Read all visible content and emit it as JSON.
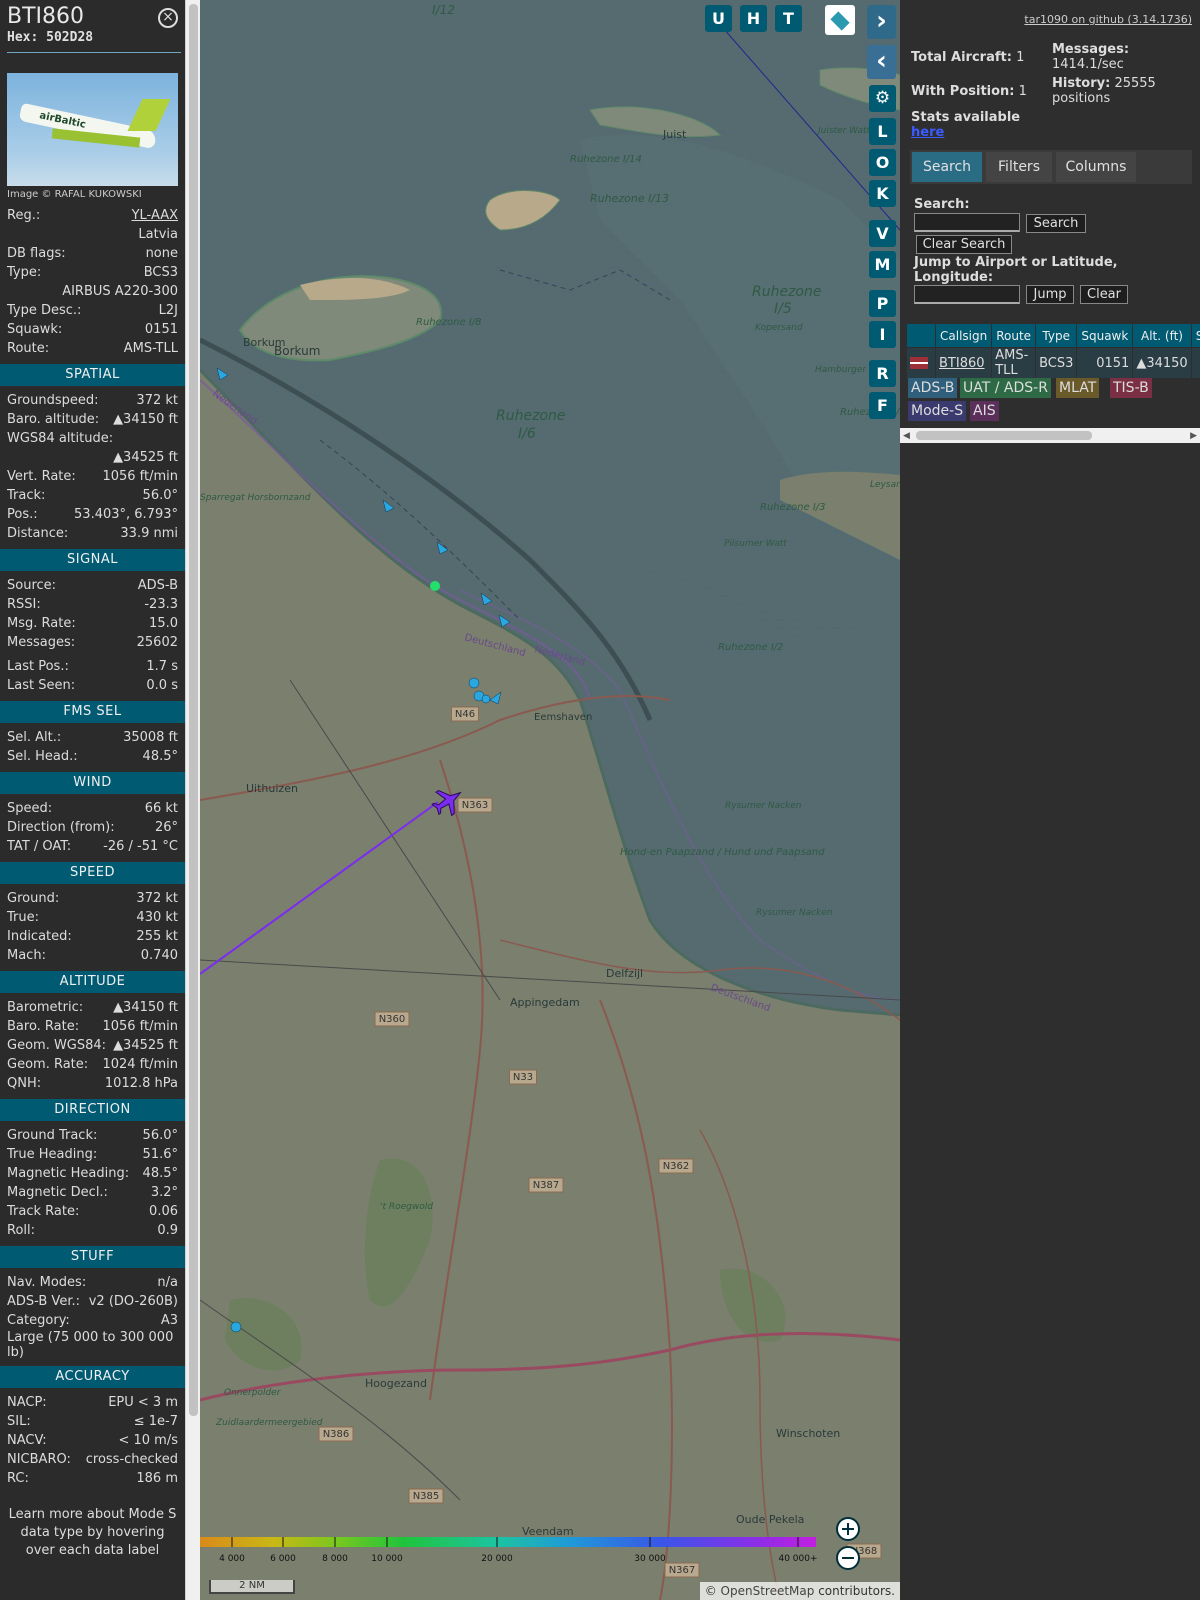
{
  "info": {
    "callsign": "BTI860",
    "hex_label": "Hex:",
    "hex": "502D28",
    "close_icon": "×",
    "photo_text": "airBaltic",
    "image_credit": "Image © RAFAL KUKOWSKI",
    "basic": [
      {
        "k": "Reg.:",
        "v": "YL-AAX"
      },
      {
        "k": "",
        "v": "Latvia"
      },
      {
        "k": "DB flags:",
        "v": "none"
      },
      {
        "k": "Type:",
        "v": "BCS3"
      },
      {
        "k": "",
        "v": "AIRBUS A220-300"
      },
      {
        "k": "Type Desc.:",
        "v": "L2J"
      },
      {
        "k": "Squawk:",
        "v": "0151"
      },
      {
        "k": "Route:",
        "v": "AMS-TLL"
      }
    ],
    "sections": {
      "spatial": "SPATIAL",
      "signal": "SIGNAL",
      "fms": "FMS SEL",
      "wind": "WIND",
      "speed": "SPEED",
      "altitude": "ALTITUDE",
      "direction": "DIRECTION",
      "stuff": "STUFF",
      "accuracy": "ACCURACY"
    },
    "spatial": [
      {
        "k": "Groundspeed:",
        "v": "372 kt"
      },
      {
        "k": "Baro. altitude:",
        "v": "▲34150 ft"
      },
      {
        "k": "WGS84 altitude:",
        "v": ""
      },
      {
        "k": "",
        "v": "▲34525 ft"
      },
      {
        "k": "Vert. Rate:",
        "v": "1056 ft/min"
      },
      {
        "k": "Track:",
        "v": "56.0°"
      },
      {
        "k": "Pos.:",
        "v": "53.403°, 6.793°"
      },
      {
        "k": "Distance:",
        "v": "33.9 nmi"
      }
    ],
    "signal": [
      {
        "k": "Source:",
        "v": "ADS-B"
      },
      {
        "k": "RSSI:",
        "v": "-23.3"
      },
      {
        "k": "Msg. Rate:",
        "v": "15.0"
      },
      {
        "k": "Messages:",
        "v": "25602"
      },
      {
        "k": "Last Pos.:",
        "v": "1.7 s"
      },
      {
        "k": "Last Seen:",
        "v": "0.0 s"
      }
    ],
    "fms": [
      {
        "k": "Sel. Alt.:",
        "v": "35008 ft"
      },
      {
        "k": "Sel. Head.:",
        "v": "48.5°"
      }
    ],
    "wind": [
      {
        "k": "Speed:",
        "v": "66 kt"
      },
      {
        "k": "Direction (from):",
        "v": "26°"
      },
      {
        "k": "TAT / OAT:",
        "v": "-26 / -51 °C"
      }
    ],
    "speed": [
      {
        "k": "Ground:",
        "v": "372 kt"
      },
      {
        "k": "True:",
        "v": "430 kt"
      },
      {
        "k": "Indicated:",
        "v": "255 kt"
      },
      {
        "k": "Mach:",
        "v": "0.740"
      }
    ],
    "altitude": [
      {
        "k": "Barometric:",
        "v": "▲34150 ft"
      },
      {
        "k": "Baro. Rate:",
        "v": "1056 ft/min"
      },
      {
        "k": "Geom. WGS84:",
        "v": "▲34525 ft"
      },
      {
        "k": "Geom. Rate:",
        "v": "1024 ft/min"
      },
      {
        "k": "QNH:",
        "v": "1012.8 hPa"
      }
    ],
    "direction": [
      {
        "k": "Ground Track:",
        "v": "56.0°"
      },
      {
        "k": "True Heading:",
        "v": "51.6°"
      },
      {
        "k": "Magnetic Heading:",
        "v": "48.5°"
      },
      {
        "k": "Magnetic Decl.:",
        "v": "3.2°"
      },
      {
        "k": "Track Rate:",
        "v": "0.06"
      },
      {
        "k": "Roll:",
        "v": "0.9"
      }
    ],
    "stuff": [
      {
        "k": "Nav. Modes:",
        "v": "n/a"
      },
      {
        "k": "ADS-B Ver.:",
        "v": "v2 (DO-260B)"
      },
      {
        "k": "Category:",
        "v": "A3"
      }
    ],
    "stuff_note": "Large (75 000 to 300 000 lb)",
    "accuracy": [
      {
        "k": "NACP:",
        "v": "EPU < 3 m"
      },
      {
        "k": "SIL:",
        "v": "≤ 1e-7"
      },
      {
        "k": "NACV:",
        "v": "< 10 m/s"
      },
      {
        "k": "NICBARO:",
        "v": "cross-checked"
      },
      {
        "k": "RC:",
        "v": "186 m"
      }
    ],
    "learn_more": "Learn more about Mode S data type by hovering over each data label"
  },
  "map": {
    "top_buttons": [
      "U",
      "H",
      "T"
    ],
    "side_buttons": [
      "L",
      "O",
      "K",
      "V",
      "M",
      "P",
      "I",
      "R",
      "F"
    ],
    "labels": {
      "i12": "I/12",
      "juist": "Juist",
      "borkum1": "Borkum",
      "borkum2": "Borkum",
      "rz14": "Ruhezone I/14",
      "rz13": "Ruhezone I/13",
      "rz8": "Ruhezone I/8",
      "rz6": "Ruhezone",
      "rz6b": "I/6",
      "rz5": "Ruhezone",
      "rz5b": "I/5",
      "rz4": "Ruhezone I/4",
      "rz3": "Ruhezone I/3",
      "rz2": "Ruhezone I/2",
      "nederland1": "Nederland",
      "deutschland": "Deutschland",
      "nederland2": "Nederland",
      "eemshaven": "Eemshaven",
      "uithuizen": "Uithuizen",
      "delfzijl": "Delfzijl",
      "appingedam": "Appingedam",
      "hoogezand": "Hoogezand",
      "winschoten": "Winschoten",
      "veendam": "Veendam",
      "oude_pekela": "Oude Pekela",
      "roegwold": "'t Roegwold",
      "onnerpolder": "Onnerpolder",
      "zuidlaarder": "Zuidlaardermeergebied",
      "hond": "Hond-en Paapzand / Hund und Paapsand",
      "rysumer1": "Rysumer Nacken",
      "rysumer2": "Rysumer Nacken",
      "pilsumer": "Pilsumer Watt",
      "deutschland2": "Deutschland",
      "kopersand": "Kopersand",
      "hamburger": "Hamburger Sand",
      "sparregat": "Sparregat Horsbornzand",
      "leysan": "Leysan",
      "juister_watt": "Juister Watt"
    },
    "roads": [
      "N46",
      "N363",
      "N360",
      "N33",
      "N362",
      "N387",
      "N386",
      "N385",
      "N367",
      "N368"
    ],
    "scale": "2 NM",
    "attribution_prefix": "© ",
    "attribution_link": "OpenStreetMap",
    "attribution_suffix": " contributors.",
    "legend_ticks": [
      "4 000",
      "6 000",
      "8 000",
      "10 000",
      "20 000",
      "30 000",
      "40 000+"
    ],
    "aircraft_track": 56.0
  },
  "side": {
    "github_link": "tar1090 on github (3.14.1736)",
    "total_aircraft_label": "Total Aircraft:",
    "total_aircraft": "1",
    "with_position_label": "With Position:",
    "with_position": "1",
    "messages_label": "Messages:",
    "messages": "1414.1/sec",
    "history_label": "History:",
    "history": "25555 positions",
    "stats_label": "Stats available",
    "stats_link": "here",
    "tabs": [
      "Search",
      "Filters",
      "Columns"
    ],
    "search_label": "Search:",
    "search_button": "Search",
    "clear_search_button": "Clear Search",
    "jump_label": "Jump to Airport or Latitude, Longitude:",
    "jump_button": "Jump",
    "clear_button": "Clear",
    "table_headers": [
      "",
      "Callsign",
      "Route",
      "Type",
      "Squawk",
      "Alt. (ft)",
      "S"
    ],
    "table_rows": [
      {
        "callsign": "BTI860",
        "route": "AMS-TLL",
        "type": "BCS3",
        "squawk": "0151",
        "alt": "▲34150"
      }
    ],
    "badges": [
      {
        "label": "ADS-B",
        "color": "#2f5f7a"
      },
      {
        "label": "UAT / ADS-R",
        "color": "#2e6a45"
      },
      {
        "label": "MLAT",
        "color": "#6a5a2a"
      },
      {
        "label": "TIS-B",
        "color": "#7a2f45"
      },
      {
        "label": "Mode-S",
        "color": "#3a3a6e"
      },
      {
        "label": "AIS",
        "color": "#5a2f5a"
      }
    ]
  },
  "colors": {
    "accent": "#005a72",
    "track": "#7b2cf0"
  }
}
